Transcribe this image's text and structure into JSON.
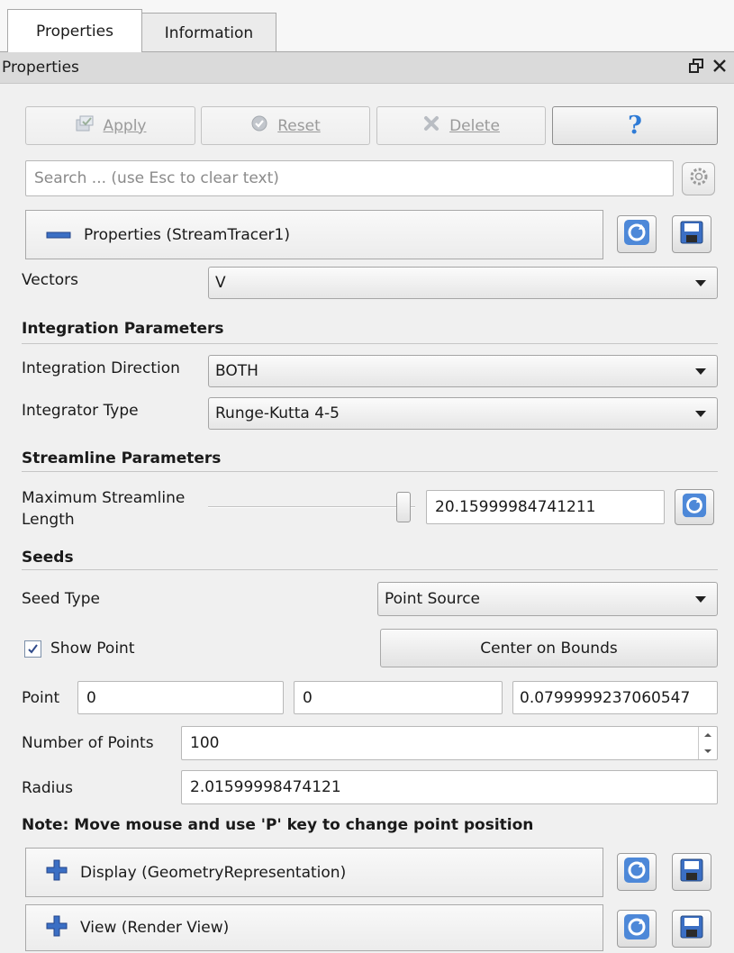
{
  "tabs": [
    "Properties",
    "Information"
  ],
  "titlebar": {
    "title": "Properties",
    "float_icon": "float-icon",
    "close_icon": "close-icon"
  },
  "toolbar": {
    "apply_label": "Apply",
    "reset_label": "Reset",
    "delete_label": "Delete",
    "help_label": "?"
  },
  "search": {
    "placeholder": "Search ... (use Esc to clear text)"
  },
  "properties_panel": {
    "label": "Properties (StreamTracer1)"
  },
  "vectors": {
    "label": "Vectors",
    "value": "V"
  },
  "integration": {
    "heading": "Integration Parameters",
    "direction_label": "Integration Direction",
    "direction_value": "BOTH",
    "type_label": "Integrator Type",
    "type_value": "Runge-Kutta 4-5"
  },
  "streamline": {
    "heading": "Streamline Parameters",
    "max_length_label_1": "Maximum Streamline",
    "max_length_label_2": "Length",
    "max_length_value": "20.15999984741211",
    "slider_fraction": 1.0
  },
  "seeds": {
    "heading": "Seeds",
    "seed_type_label": "Seed Type",
    "seed_type_value": "Point Source",
    "show_point_label": "Show Point",
    "show_point_checked": true,
    "center_bounds_label": "Center on Bounds",
    "point_label": "Point",
    "point_x": "0",
    "point_y": "0",
    "point_z": "0.0799999237060547",
    "num_points_label": "Number of Points",
    "num_points_value": "100",
    "radius_label": "Radius",
    "radius_value": "2.01599998474121",
    "note": "Note: Move mouse and use 'P' key to change point position"
  },
  "display_panel": {
    "label": "Display (GeometryRepresentation)"
  },
  "view_panel": {
    "label": "View (Render View)"
  },
  "colors": {
    "accent_blue": "#3b6fc4",
    "help_blue": "#2e7bd6"
  }
}
